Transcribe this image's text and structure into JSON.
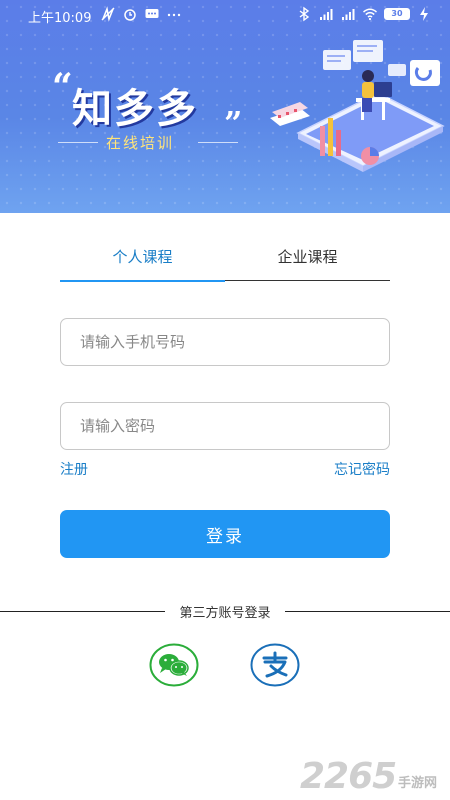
{
  "status_bar": {
    "time": "上午10:09",
    "battery": "30"
  },
  "brand": {
    "name": "知多多",
    "subtitle": "在线培训"
  },
  "tabs": [
    {
      "label": "个人课程",
      "active": true
    },
    {
      "label": "企业课程",
      "active": false
    }
  ],
  "form": {
    "phone_placeholder": "请输入手机号码",
    "password_placeholder": "请输入密码",
    "register_label": "注册",
    "forgot_label": "忘记密码",
    "login_label": "登录"
  },
  "third_party": {
    "label": "第三方账号登录",
    "wechat_icon": "wechat-icon",
    "alipay_icon": "alipay-icon"
  },
  "watermark": {
    "number": "2265",
    "text": "手游网"
  },
  "colors": {
    "accent": "#2196f3",
    "link": "#1a7ec7",
    "hero": "#5b7de8",
    "brand_sub": "#ffe47a",
    "wechat": "#2bad3a",
    "alipay": "#1a6fb8"
  }
}
